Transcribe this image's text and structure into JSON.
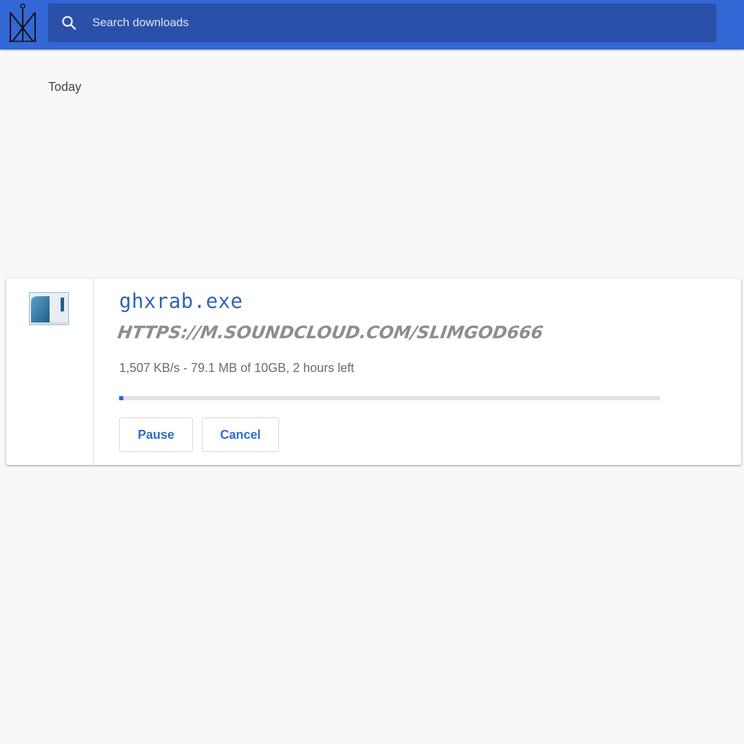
{
  "toolbar": {
    "logo_icon": "monogram-logo-icon",
    "background_color": "#3367d6",
    "search": {
      "icon": "search-icon",
      "placeholder": "Search downloads",
      "value": ""
    }
  },
  "downloads": {
    "section_label": "Today",
    "items": [
      {
        "icon": "executable-file-icon",
        "file_name": "ghxrab.exe",
        "url": "HTTPS://M.SOUNDCLOUD.COM/SLIMGOD666",
        "status": "1,507 KB/s - 79.1 MB of 10GB, 2 hours left",
        "progress_fraction": 0.0079,
        "pause_label": "Pause",
        "cancel_label": "Cancel"
      }
    ]
  },
  "colors": {
    "accent": "#3367d6",
    "link_blue": "#2f64b8",
    "button_text": "#2f6cd0"
  }
}
